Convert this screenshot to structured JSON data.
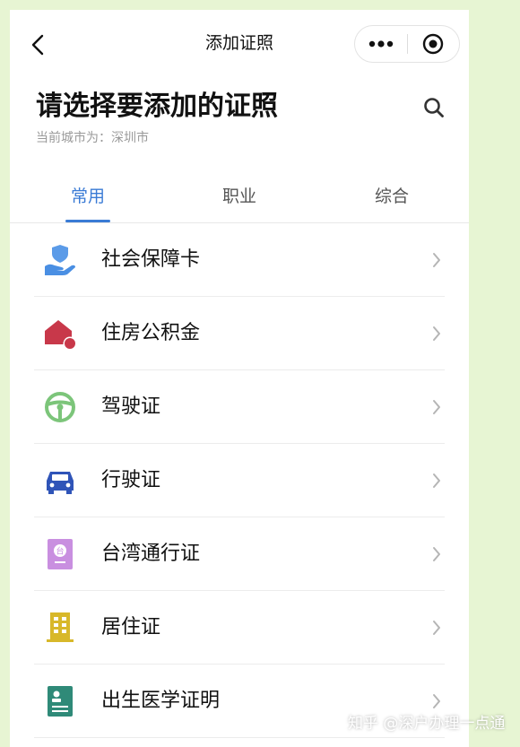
{
  "navbar": {
    "title": "添加证照",
    "back_icon": "chevron-left-icon",
    "more_icon": "more-dots-icon",
    "close_icon": "target-close-icon"
  },
  "header": {
    "title": "请选择要添加的证照",
    "city_prefix": "当前城市为：",
    "city_name": "深圳市",
    "search_icon": "search-icon"
  },
  "tabs": [
    {
      "label": "常用",
      "active": true
    },
    {
      "label": "职业",
      "active": false
    },
    {
      "label": "综合",
      "active": false
    }
  ],
  "items": [
    {
      "label": "社会保障卡",
      "icon": "social-security-icon",
      "color": "#4a8fe3"
    },
    {
      "label": "住房公积金",
      "icon": "housing-fund-icon",
      "color": "#c8384a"
    },
    {
      "label": "驾驶证",
      "icon": "steering-wheel-icon",
      "color": "#7cc57a"
    },
    {
      "label": "行驶证",
      "icon": "car-icon",
      "color": "#2f54b8"
    },
    {
      "label": "台湾通行证",
      "icon": "taiwan-permit-icon",
      "color": "#c98fe0"
    },
    {
      "label": "居住证",
      "icon": "building-icon",
      "color": "#d8b82a"
    },
    {
      "label": "出生医学证明",
      "icon": "birth-certificate-icon",
      "color": "#2f8a78"
    }
  ],
  "watermark": "知乎 @深户办理一点通",
  "colors": {
    "accent": "#3a7bd5",
    "background": "#e7f5d3"
  }
}
